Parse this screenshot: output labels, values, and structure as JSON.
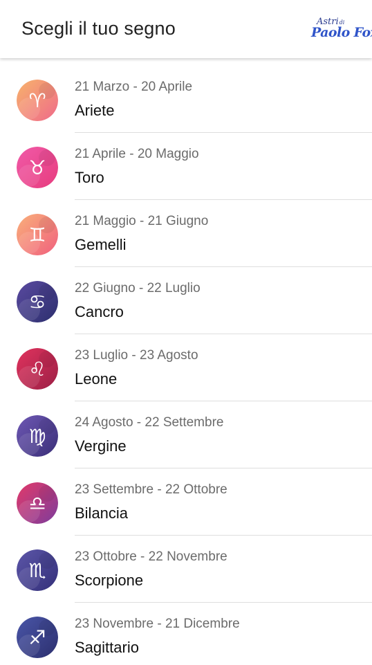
{
  "header": {
    "title": "Scegli il tuo segno",
    "brand_top": "Astri",
    "brand_di": "di",
    "brand_bottom": "Paolo Fox"
  },
  "signs": [
    {
      "name": "Ariete",
      "dates": "21 Marzo - 20 Aprile",
      "icon": "aries-icon",
      "glyph": "♈",
      "colors": [
        "#f7b36b",
        "#ef6a8a"
      ]
    },
    {
      "name": "Toro",
      "dates": "21 Aprile - 20 Maggio",
      "icon": "taurus-icon",
      "glyph": "♉",
      "colors": [
        "#f05aa8",
        "#e73c7e"
      ]
    },
    {
      "name": "Gemelli",
      "dates": "21 Maggio - 21 Giugno",
      "icon": "gemini-icon",
      "glyph": "♊",
      "colors": [
        "#f9b07a",
        "#f0607e"
      ]
    },
    {
      "name": "Cancro",
      "dates": "22 Giugno - 22 Luglio",
      "icon": "cancer-icon",
      "glyph": "♋",
      "colors": [
        "#5a4aa0",
        "#2c2f6e"
      ]
    },
    {
      "name": "Leone",
      "dates": "23 Luglio - 23 Agosto",
      "icon": "leo-icon",
      "glyph": "♌",
      "colors": [
        "#e0335e",
        "#9c1f45"
      ]
    },
    {
      "name": "Vergine",
      "dates": "24 Agosto - 22 Settembre",
      "icon": "virgo-icon",
      "glyph": "♍",
      "colors": [
        "#6e58b4",
        "#3a2f78"
      ]
    },
    {
      "name": "Bilancia",
      "dates": "23 Settembre - 22 Ottobre",
      "icon": "libra-icon",
      "glyph": "♎",
      "colors": [
        "#e23a6a",
        "#7d3c9c"
      ]
    },
    {
      "name": "Scorpione",
      "dates": "23 Ottobre - 22 Novembre",
      "icon": "scorpio-icon",
      "glyph": "♏",
      "colors": [
        "#5c56a8",
        "#34307a"
      ]
    },
    {
      "name": "Sagittario",
      "dates": "23 Novembre - 21 Dicembre",
      "icon": "sagittarius-icon",
      "glyph": "♐",
      "colors": [
        "#4a56a8",
        "#2c2f6e"
      ]
    }
  ]
}
